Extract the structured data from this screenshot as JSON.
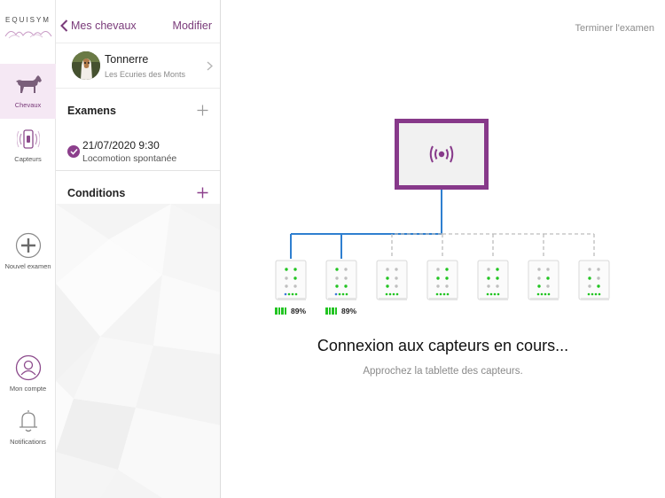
{
  "brand": {
    "logo_text": "EQUISYM"
  },
  "rail": {
    "items": [
      {
        "id": "horses",
        "label": "Chevaux",
        "icon": "horse-icon",
        "active": true
      },
      {
        "id": "sensors",
        "label": "Capteurs",
        "icon": "sensor-icon",
        "active": false
      },
      {
        "id": "new-exam",
        "label": "Nouvel examen",
        "icon": "plus-circle-icon",
        "active": false
      },
      {
        "id": "account",
        "label": "Mon compte",
        "icon": "user-icon",
        "active": false
      },
      {
        "id": "notifications",
        "label": "Notifications",
        "icon": "bell-icon",
        "active": false
      }
    ]
  },
  "panel": {
    "back_label": "Mes chevaux",
    "edit_label": "Modifier",
    "horse": {
      "name": "Tonnerre",
      "stable": "Les Ecuries des Monts"
    },
    "exams_title": "Examens",
    "exams": [
      {
        "date": "21/07/2020 9:30",
        "type": "Locomotion spontanée",
        "done": true
      }
    ],
    "conditions_title": "Conditions"
  },
  "main": {
    "finish_label": "Terminer l'examen",
    "status_title": "Connexion aux capteurs en cours...",
    "status_subtitle": "Approchez la tablette des capteurs.",
    "sensors": [
      {
        "id": 1,
        "connected": true,
        "battery": "89%"
      },
      {
        "id": 2,
        "connected": true,
        "battery": "89%"
      },
      {
        "id": 3,
        "connected": false,
        "battery": ""
      },
      {
        "id": 4,
        "connected": false,
        "battery": ""
      },
      {
        "id": 5,
        "connected": false,
        "battery": ""
      },
      {
        "id": 6,
        "connected": false,
        "battery": ""
      },
      {
        "id": 7,
        "connected": false,
        "battery": ""
      }
    ]
  },
  "colors": {
    "accent": "#87398a",
    "link": "#7a3b7a",
    "wire_connected": "#2f7fd0",
    "wire_pending": "#bdbdbd",
    "led_green": "#22c422",
    "led_grey": "#bfbfbf",
    "led_blue": "#3b77d6"
  }
}
